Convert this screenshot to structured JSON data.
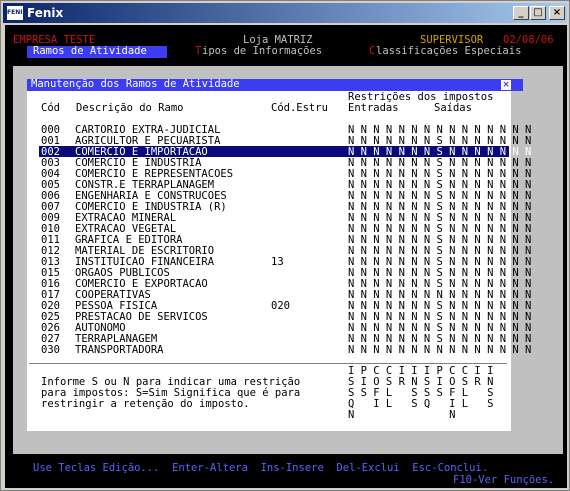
{
  "window": {
    "title": "Fenix",
    "icon_text": "FENIX",
    "min": "_",
    "max": "□",
    "close": "×"
  },
  "header": {
    "company": "EMPRESA TESTE",
    "store": "Loja MATRIZ",
    "user": "SUPERVISOR",
    "date": "02/08/06"
  },
  "menu": [
    {
      "key": "",
      "label": "Ramos de Atividade"
    },
    {
      "key": "T",
      "label": "ipos de Informações"
    },
    {
      "key": "C",
      "label": "lassificações Especiais"
    }
  ],
  "dialog": {
    "title": "Manutenção dos Ramos de Atividade",
    "close": "×",
    "col_cod": "Cód",
    "col_desc": "Descrição do Ramo",
    "col_codestru": "Cód.Estru",
    "col_restr": "Restrições dos impostos",
    "col_entradas": "Entradas",
    "col_saidas": "Saídas"
  },
  "rows": [
    {
      "cod": "000",
      "desc": "CARTORIO EXTRA-JUDICIAL",
      "estru": "",
      "flags": "N N N N N N N N N N N N N N N"
    },
    {
      "cod": "001",
      "desc": "AGRICULTOR E PECUARISTA",
      "estru": "",
      "flags": "N N N N N N N S N N N N N N N"
    },
    {
      "cod": "002",
      "desc": "COMERCIO E IMPORTACAO",
      "estru": "",
      "flags": "N N N N N N N S N N N N N N N"
    },
    {
      "cod": "003",
      "desc": "COMERCIO E INDUSTRIA",
      "estru": "",
      "flags": "N N N N N N N S N N N N N N N"
    },
    {
      "cod": "004",
      "desc": "COMERCIO E REPRESENTACOES",
      "estru": "",
      "flags": "N N N N N N N S N N N N N N N"
    },
    {
      "cod": "005",
      "desc": "CONSTR.E TERRAPLANAGEM",
      "estru": "",
      "flags": "N N N N N N N S N N N N N N N"
    },
    {
      "cod": "006",
      "desc": "ENGENHARIA E CONSTRUCOES",
      "estru": "",
      "flags": "N N N N N N N S N N N N N N N"
    },
    {
      "cod": "007",
      "desc": "COMERCIO E INDUSTRIA (R)",
      "estru": "",
      "flags": "N N N N N N N S N N N N N N N"
    },
    {
      "cod": "009",
      "desc": "EXTRACAO MINERAL",
      "estru": "",
      "flags": "N N N N N N N S N N N N N N N"
    },
    {
      "cod": "010",
      "desc": "EXTRACAO VEGETAL",
      "estru": "",
      "flags": "N N N N N N N S N N N N N N N"
    },
    {
      "cod": "011",
      "desc": "GRAFICA E EDITORA",
      "estru": "",
      "flags": "N N N N N N N S N N N N N N N"
    },
    {
      "cod": "012",
      "desc": "MATERIAL DE ESCRITORIO",
      "estru": "",
      "flags": "N N N N N N N S N N N N N N N"
    },
    {
      "cod": "013",
      "desc": "INSTITUICAO FINANCEIRA",
      "estru": "13",
      "flags": "N N N N N N N S N N N N N N N"
    },
    {
      "cod": "015",
      "desc": "ORGAOS PUBLICOS",
      "estru": "",
      "flags": "N N N N N N N S N N N N N N N"
    },
    {
      "cod": "016",
      "desc": "COMERCIO E EXPORTACAO",
      "estru": "",
      "flags": "N N N N N N N S N N N N N N N"
    },
    {
      "cod": "017",
      "desc": "COOPERATIVAS",
      "estru": "",
      "flags": "N N N N N N N N N N N N N N N"
    },
    {
      "cod": "020",
      "desc": "PESSOA FISICA",
      "estru": "020",
      "flags": "N N N N N N N S N N N N N N N"
    },
    {
      "cod": "025",
      "desc": "PRESTACAO DE SERVICOS",
      "estru": "",
      "flags": "N N N N N N N S N N N N N N N"
    },
    {
      "cod": "026",
      "desc": "AUTONOMO",
      "estru": "",
      "flags": "N N N N N N N S N N N N N N N"
    },
    {
      "cod": "027",
      "desc": "TERRAPLANAGEM",
      "estru": "",
      "flags": "N N N N N N N S N N N N N N N"
    },
    {
      "cod": "030",
      "desc": "TRANSPORTADORA",
      "estru": "",
      "flags": "N N N N N N N N N N N N N N N"
    }
  ],
  "selected_index": 2,
  "info": [
    "Informe S ou N para indicar uma restrição",
    "para impostos: S=Sim Significa que é para",
    "restringir a retenção do imposto."
  ],
  "legend": [
    "I P C C I I I P C C I I",
    "S I O S R N S I O S R N",
    "S S F L   S S S F L   S",
    "Q   I L   S Q   I L   S",
    "N               N"
  ],
  "footer": {
    "line1": "Use Teclas Edição...  Enter-Altera  Ins-Insere  Del-Exclui  Esc-Conclui.",
    "line2": "F10-Ver Funções."
  }
}
